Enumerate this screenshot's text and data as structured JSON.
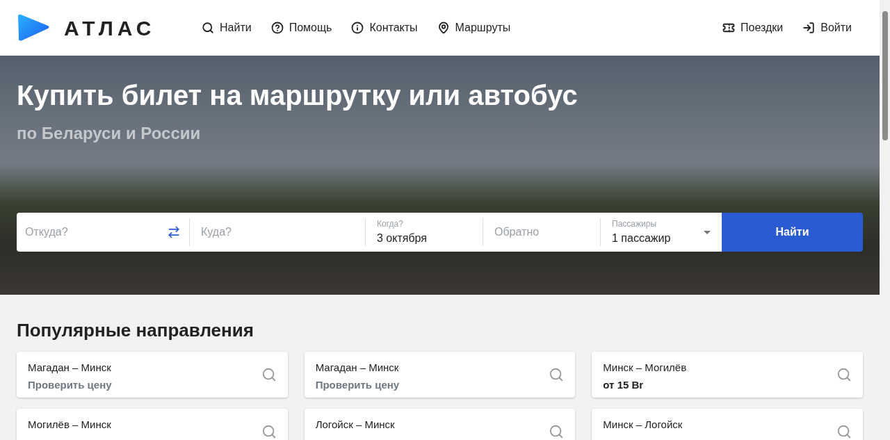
{
  "header": {
    "logo": "АТЛАС",
    "nav": [
      {
        "kind": "search",
        "label": "Найти"
      },
      {
        "kind": "help",
        "label": "Помощь"
      },
      {
        "kind": "info",
        "label": "Контакты"
      },
      {
        "kind": "pin",
        "label": "Маршруты"
      }
    ],
    "actions": [
      {
        "kind": "ticket",
        "label": "Поездки"
      },
      {
        "kind": "login",
        "label": "Войти"
      }
    ]
  },
  "hero": {
    "title": "Купить билет на маршрутку или автобус",
    "subtitle": "по Беларуси и России"
  },
  "search": {
    "from": {
      "placeholder": "Откуда?"
    },
    "to": {
      "placeholder": "Куда?"
    },
    "date": {
      "label": "Когда?",
      "value": "3 октября"
    },
    "return": {
      "placeholder": "Обратно"
    },
    "passengers": {
      "label": "Пассажиры",
      "value": "1 пассажир"
    },
    "button": "Найти"
  },
  "popular": {
    "title": "Популярные направления",
    "routes": [
      {
        "route": "Магадан – Минск",
        "kind": "check",
        "price": "Проверить цену"
      },
      {
        "route": "Магадан – Минск",
        "kind": "check",
        "price": "Проверить цену"
      },
      {
        "route": "Минск – Могилёв",
        "kind": "price",
        "price": "от 15 Br"
      },
      {
        "route": "Могилёв – Минск"
      },
      {
        "route": "Логойск – Минск"
      },
      {
        "route": "Минск – Логойск"
      }
    ]
  }
}
